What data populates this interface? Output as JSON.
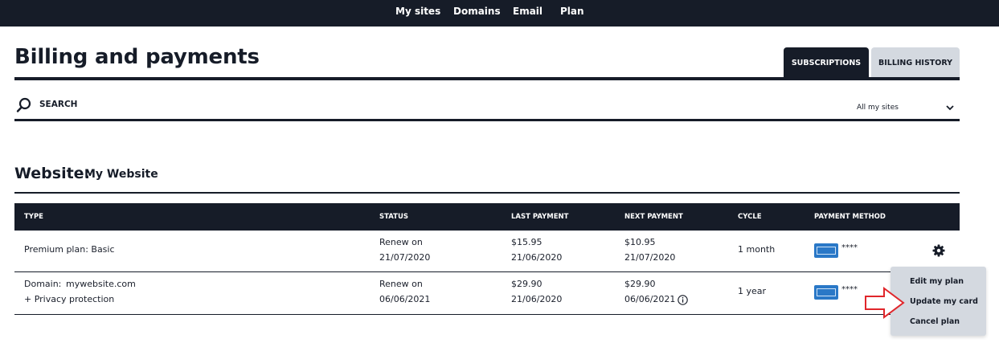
{
  "topnav": {
    "items": [
      {
        "label": "My sites"
      },
      {
        "label": "Domains"
      },
      {
        "label": "Email"
      },
      {
        "label": "Plan"
      }
    ]
  },
  "header": {
    "title": "Billing and payments",
    "tabs": [
      {
        "label": "SUBSCRIPTIONS",
        "active": true
      },
      {
        "label": "BILLING HISTORY",
        "active": false
      }
    ]
  },
  "search": {
    "label": "SEARCH",
    "icon": "search-icon"
  },
  "filter": {
    "value": "All my sites",
    "icon": "chevron-down-icon"
  },
  "section": {
    "label": "Website:",
    "value": "My Website"
  },
  "table": {
    "columns": [
      "TYPE",
      "STATUS",
      "LAST PAYMENT",
      "NEXT PAYMENT",
      "CYCLE",
      "PAYMENT METHOD"
    ],
    "rows": [
      {
        "type_line1": "Premium plan: Basic",
        "type_line2": "",
        "status_line1": "Renew on",
        "status_line2": "21/07/2020",
        "last_amount": "$15.95",
        "last_date": "21/06/2020",
        "next_amount": "$10.95",
        "next_date": "21/07/2020",
        "cycle": "1 month",
        "card_icon": "amex-card-icon",
        "card_masked": "****"
      },
      {
        "type_line1": "Domain:",
        "type_domain": "mywebsite.com",
        "type_line2": "+ Privacy protection",
        "status_line1": "Renew on",
        "status_line2": "06/06/2021",
        "last_amount": "$29.90",
        "last_date": "21/06/2020",
        "next_amount": "$29.90",
        "next_date": "06/06/2021",
        "cycle": "1 year",
        "card_icon": "amex-card-icon",
        "card_masked": "****"
      }
    ]
  },
  "actions_menu": {
    "icon": "gear-icon",
    "items": [
      {
        "label": "Edit my plan"
      },
      {
        "label": "Update my card"
      },
      {
        "label": "Cancel plan"
      }
    ]
  },
  "colors": {
    "navy": "#161c28",
    "tab_inactive": "#d4d9e0",
    "amex_blue": "#2a78c7",
    "arrow_red": "#e0262b"
  }
}
